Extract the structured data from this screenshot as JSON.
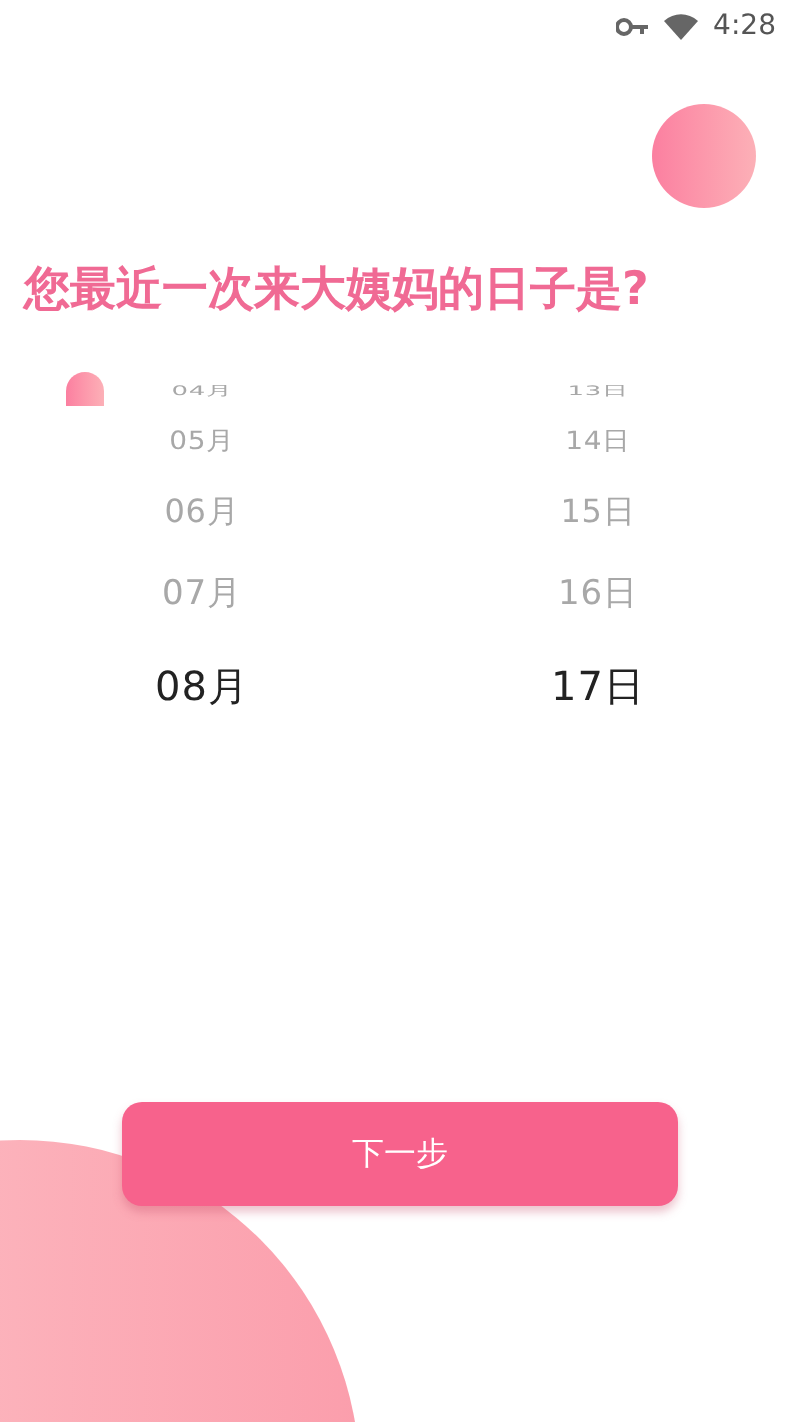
{
  "status_bar": {
    "time": "4:28"
  },
  "title": "您最近一次来大姨妈的日子是?",
  "picker": {
    "months": [
      {
        "label": "04月",
        "selected": false
      },
      {
        "label": "05月",
        "selected": false
      },
      {
        "label": "06月",
        "selected": false
      },
      {
        "label": "07月",
        "selected": false
      },
      {
        "label": "08月",
        "selected": true
      }
    ],
    "days": [
      {
        "label": "13日",
        "selected": false
      },
      {
        "label": "14日",
        "selected": false
      },
      {
        "label": "15日",
        "selected": false
      },
      {
        "label": "16日",
        "selected": false
      },
      {
        "label": "17日",
        "selected": true
      }
    ]
  },
  "next_button": {
    "label": "下一步"
  }
}
